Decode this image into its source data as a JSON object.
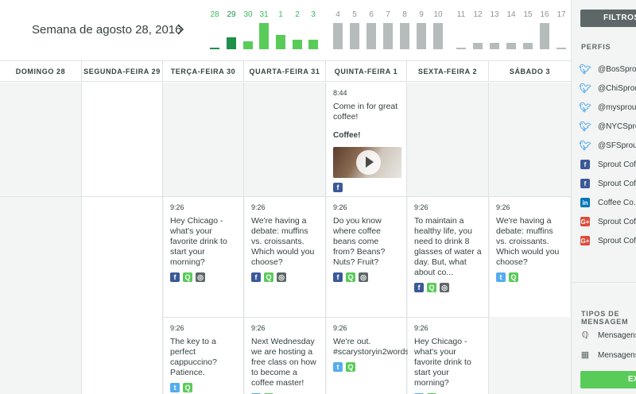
{
  "header": {
    "week_title": "Semana de agosto 28, 2016",
    "next_icon": "chevron-right-icon"
  },
  "volume_bars": [
    {
      "day": "28",
      "level": 0.05,
      "color": "#1f8f4c",
      "num_color": "#3cb85c"
    },
    {
      "day": "29",
      "level": 0.45,
      "color": "#1f8f4c",
      "num_color": "#1f8f4c"
    },
    {
      "day": "30",
      "level": 0.3,
      "color": "#59cb59",
      "num_color": "#3cb85c"
    },
    {
      "day": "31",
      "level": 1.0,
      "color": "#59cb59",
      "num_color": "#3cb85c"
    },
    {
      "day": "1",
      "level": 0.55,
      "color": "#59cb59",
      "num_color": "#3cb85c"
    },
    {
      "day": "2",
      "level": 0.35,
      "color": "#59cb59",
      "num_color": "#3cb85c"
    },
    {
      "day": "3",
      "level": 0.35,
      "color": "#59cb59",
      "num_color": "#3cb85c"
    },
    {
      "day": "4",
      "level": 1.0,
      "color": "#b6bbbb",
      "num_color": "#8c9494"
    },
    {
      "day": "5",
      "level": 1.0,
      "color": "#b6bbbb",
      "num_color": "#8c9494"
    },
    {
      "day": "6",
      "level": 1.0,
      "color": "#b6bbbb",
      "num_color": "#8c9494"
    },
    {
      "day": "7",
      "level": 1.0,
      "color": "#b6bbbb",
      "num_color": "#8c9494"
    },
    {
      "day": "8",
      "level": 1.0,
      "color": "#b6bbbb",
      "num_color": "#8c9494"
    },
    {
      "day": "9",
      "level": 1.0,
      "color": "#b6bbbb",
      "num_color": "#8c9494"
    },
    {
      "day": "10",
      "level": 1.0,
      "color": "#b6bbbb",
      "num_color": "#8c9494"
    },
    {
      "day": "11",
      "level": 0.05,
      "color": "#b6bbbb",
      "num_color": "#8c9494"
    },
    {
      "day": "12",
      "level": 0.25,
      "color": "#b6bbbb",
      "num_color": "#8c9494"
    },
    {
      "day": "13",
      "level": 0.25,
      "color": "#b6bbbb",
      "num_color": "#8c9494"
    },
    {
      "day": "14",
      "level": 0.25,
      "color": "#b6bbbb",
      "num_color": "#8c9494"
    },
    {
      "day": "15",
      "level": 0.25,
      "color": "#b6bbbb",
      "num_color": "#8c9494"
    },
    {
      "day": "16",
      "level": 1.0,
      "color": "#b6bbbb",
      "num_color": "#8c9494"
    },
    {
      "day": "17",
      "level": 0.05,
      "color": "#b6bbbb",
      "num_color": "#8c9494"
    }
  ],
  "days": [
    "DOMINGO 28",
    "SEGUNDA-FEIRA 29",
    "TERÇA-FEIRA 30",
    "QUARTA-FEIRA 31",
    "QUINTA-FEIRA 1",
    "SEXTA-FEIRA 2",
    "SÁBADO 3"
  ],
  "posts": {
    "thu_morning": {
      "time": "8:44",
      "text": "Come in for great coffee!",
      "bold": "Coffee!",
      "icons": [
        "facebook-icon"
      ]
    },
    "tue_a": {
      "time": "9:26",
      "text": "Hey Chicago - what's your favorite drink to start your morning?",
      "icons": [
        "facebook-icon",
        "sprout-icon",
        "instagram-icon"
      ]
    },
    "wed_a": {
      "time": "9:26",
      "text": "We're having a debate: muffins vs. croissants. Which would you choose?",
      "icons": [
        "facebook-icon",
        "sprout-icon",
        "instagram-icon"
      ]
    },
    "thu_a": {
      "time": "9:26",
      "text": "Do you know where coffee beans come from? Beans? Nuts? Fruit?",
      "icons": [
        "facebook-icon",
        "sprout-icon",
        "instagram-icon"
      ]
    },
    "fri_a": {
      "time": "9:26",
      "text": "To maintain a healthy life, you need to drink 8 glasses of water a day. But, what about co...",
      "icons": [
        "facebook-icon",
        "sprout-icon",
        "instagram-icon"
      ]
    },
    "sat_a": {
      "time": "9:26",
      "text": "We're having a debate: muffins vs. croissants. Which would you choose?",
      "icons": [
        "twitter-icon",
        "sprout-icon"
      ]
    },
    "tue_b": {
      "time": "9:26",
      "text": "The key to a perfect cappuccino? Patience.",
      "icons": [
        "twitter-icon",
        "sprout-icon"
      ]
    },
    "wed_b": {
      "time": "9:26",
      "text": "Next Wednesday we are hosting a free class on how to become a coffee master!",
      "icons": [
        "twitter-icon",
        "sprout-icon"
      ]
    },
    "thu_b": {
      "time": "9:26",
      "text": "We're out. #scarystoryin2words",
      "icons": [
        "twitter-icon",
        "sprout-icon"
      ]
    },
    "fri_b": {
      "time": "9:26",
      "text": "Hey Chicago - what's your favorite drink to start your morning?",
      "icons": [
        "twitter-icon",
        "sprout-icon"
      ]
    }
  },
  "sidebar": {
    "filters_label": "FILTROS",
    "profiles_title": "PERFIS",
    "profiles": [
      {
        "label": "@BosSprout",
        "icon": "twitter-icon"
      },
      {
        "label": "@ChiSprout",
        "icon": "twitter-icon"
      },
      {
        "label": "@mysprout",
        "icon": "twitter-icon"
      },
      {
        "label": "@NYCSprout",
        "icon": "twitter-icon"
      },
      {
        "label": "@SFSprout",
        "icon": "twitter-icon"
      },
      {
        "label": "Sprout Coffee",
        "icon": "facebook-icon"
      },
      {
        "label": "Sprout Coffee",
        "icon": "facebook-icon"
      },
      {
        "label": "Coffee Co.",
        "icon": "linkedin-icon"
      },
      {
        "label": "Sprout Coffee",
        "icon": "google-plus-icon"
      },
      {
        "label": "Sprout Coffee",
        "icon": "google-plus-icon"
      }
    ],
    "message_types_title": "TIPOS DE MENSAGEM",
    "message_types": [
      {
        "label": "Mensagens",
        "icon": "sprout-icon"
      },
      {
        "label": "Mensagens",
        "icon": "calendar-icon"
      }
    ],
    "export_label": "EXPORTAR"
  }
}
